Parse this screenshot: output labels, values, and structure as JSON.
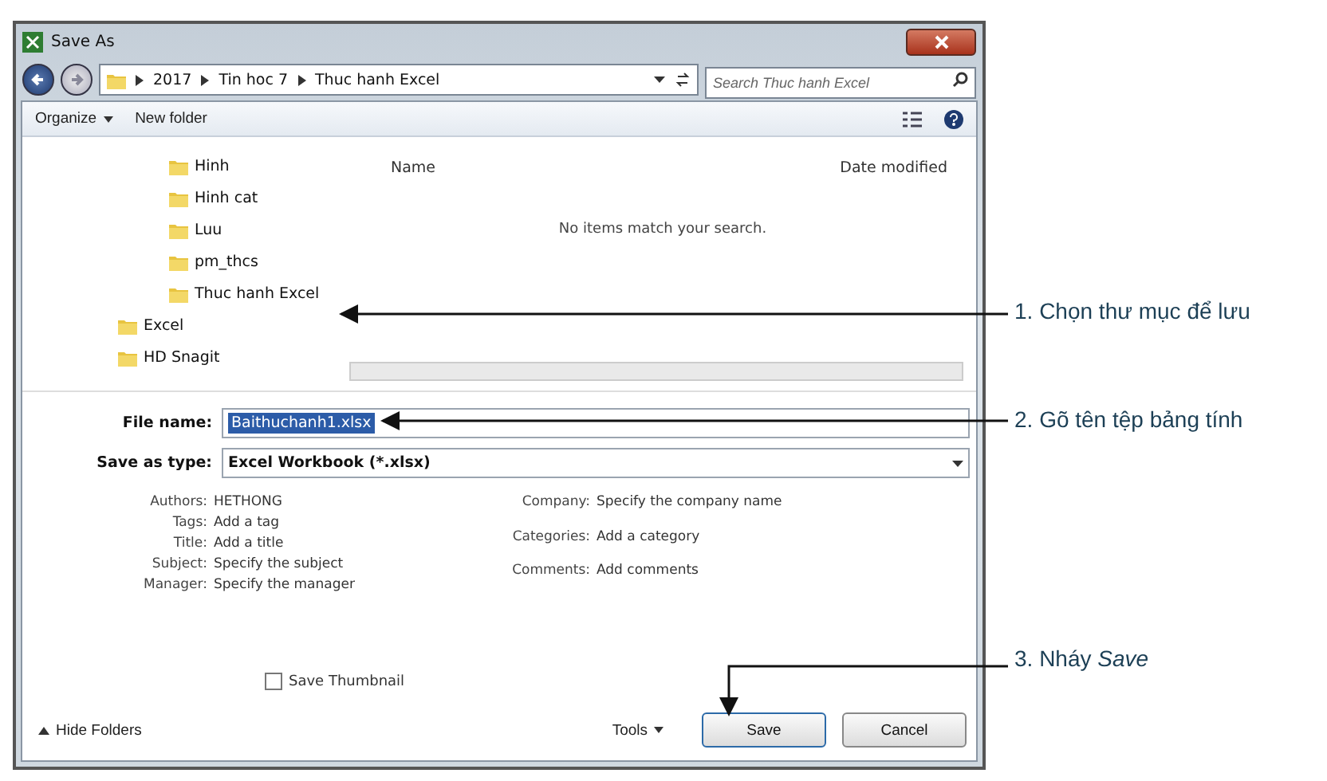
{
  "window": {
    "title": "Save As"
  },
  "address": {
    "crumbs": [
      "2017",
      "Tin hoc 7",
      "Thuc hanh Excel"
    ],
    "search_placeholder": "Search Thuc hanh Excel"
  },
  "toolbar": {
    "organize": "Organize",
    "new_folder": "New folder"
  },
  "navigation": {
    "nested_items": [
      {
        "label": "Hinh"
      },
      {
        "label": "Hinh cat"
      },
      {
        "label": "Luu"
      },
      {
        "label": "pm_thcs"
      },
      {
        "label": "Thuc hanh Excel"
      }
    ],
    "items": [
      {
        "label": "Excel"
      },
      {
        "label": "HD Snagit"
      }
    ]
  },
  "file_list": {
    "columns": [
      "Name",
      "Date modified"
    ],
    "empty_message": "No items match your search."
  },
  "form": {
    "file_name": {
      "label": "File name:",
      "value": "Baithuchanh1.xlsx"
    },
    "save_as_type": {
      "label": "Save as type:",
      "value": "Excel Workbook (*.xlsx)"
    }
  },
  "metadata_left": [
    {
      "label": "Authors:",
      "value": "HETHONG"
    },
    {
      "label": "Tags:",
      "value": "Add a tag"
    },
    {
      "label": "Title:",
      "value": "Add a title"
    },
    {
      "label": "Subject:",
      "value": "Specify the subject"
    },
    {
      "label": "Manager:",
      "value": "Specify the manager"
    }
  ],
  "metadata_right": [
    {
      "label": "Company:",
      "value": "Specify the company name"
    },
    {
      "label": "Categories:",
      "value": "Add a category"
    },
    {
      "label": "Comments:",
      "value": "Add comments"
    }
  ],
  "save_thumbnail": {
    "label": "Save Thumbnail",
    "checked": false
  },
  "footer": {
    "hide_folders": "Hide Folders",
    "tools": "Tools",
    "buttons": [
      "Save",
      "Cancel"
    ]
  },
  "callouts": [
    "1. Chọn thư mục để lưu",
    "2. Gõ tên tệp bảng tính",
    "3. Nháy *Save*"
  ]
}
